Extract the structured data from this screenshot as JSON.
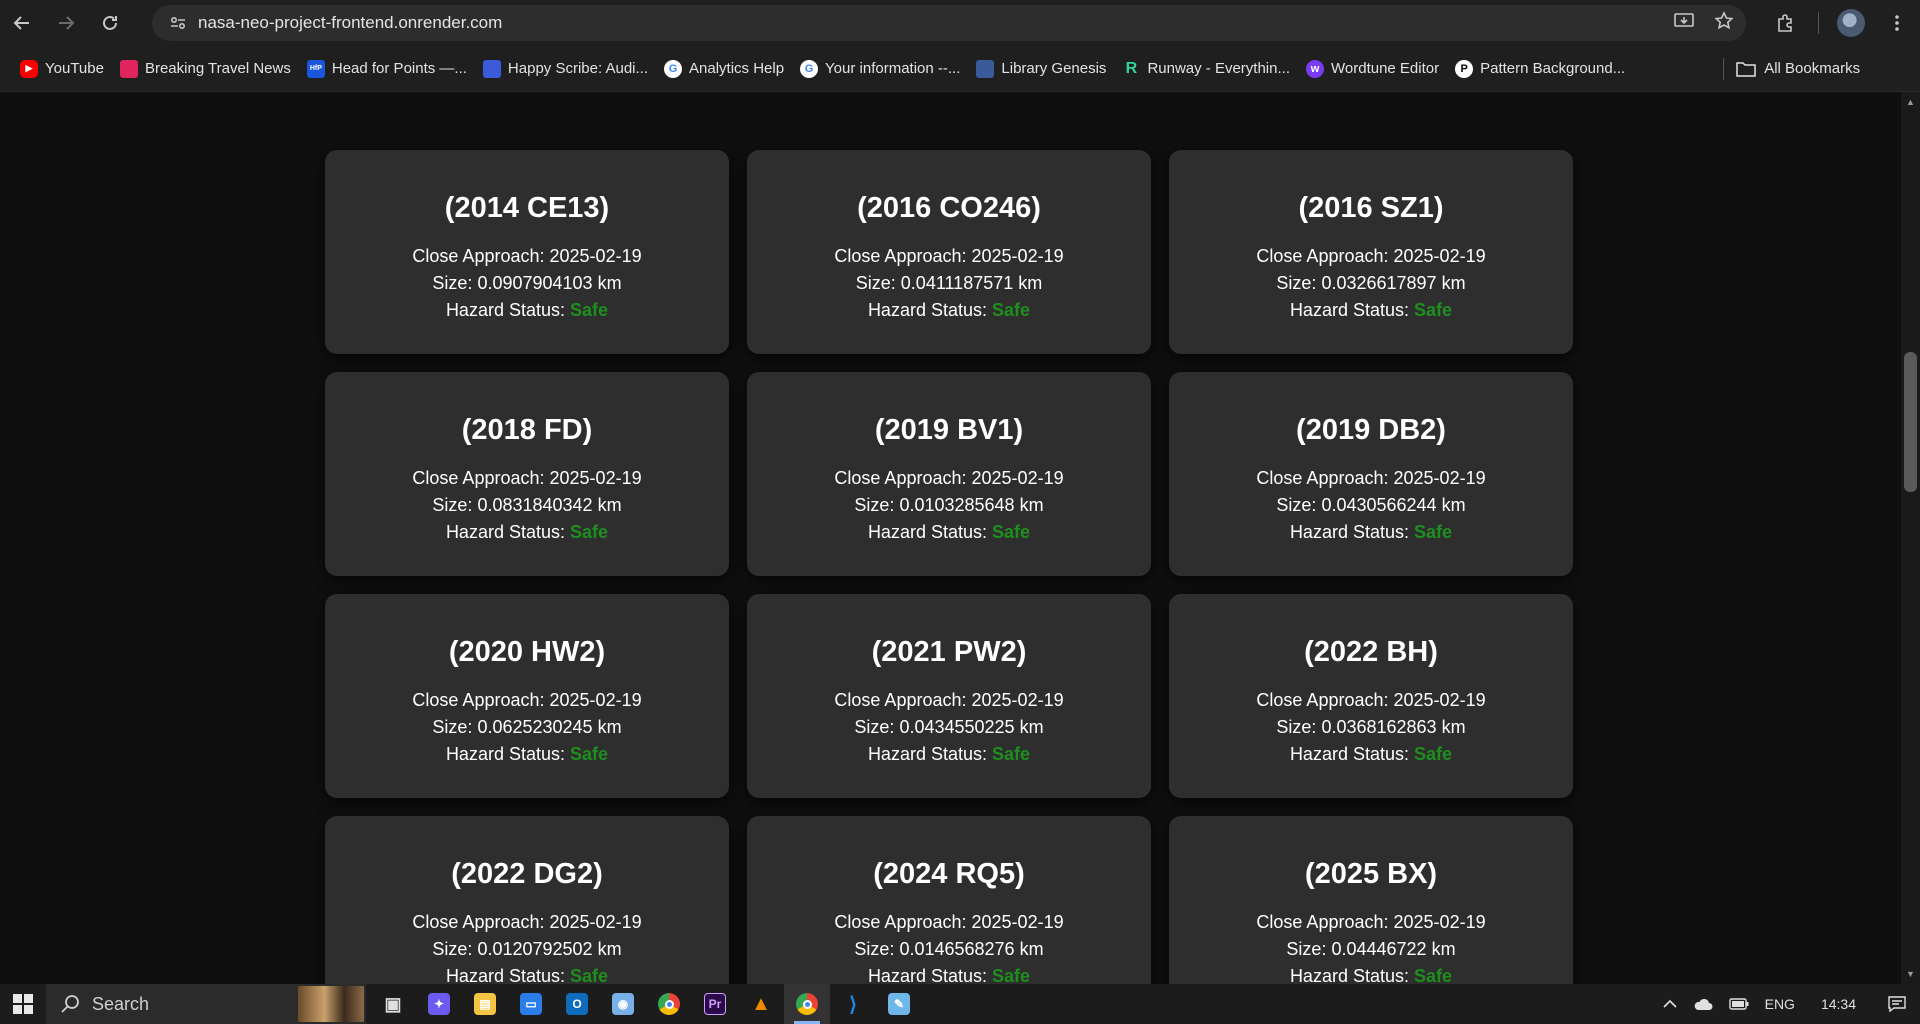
{
  "browser": {
    "url": "nasa-neo-project-frontend.onrender.com",
    "bookmarks": [
      {
        "label": "YouTube",
        "icon": "youtube-icon",
        "color": "#ff0000"
      },
      {
        "label": "Breaking Travel News",
        "icon": "breaking-travel-news-icon",
        "color": "#e0245e"
      },
      {
        "label": "Head for Points —...",
        "icon": "hfp-icon",
        "color": "#1a56db"
      },
      {
        "label": "Happy Scribe: Audi...",
        "icon": "happy-scribe-icon",
        "color": "#3b5bdb"
      },
      {
        "label": "Analytics Help",
        "icon": "google-icon",
        "color": "#4285f4"
      },
      {
        "label": "Your information --...",
        "icon": "google-icon",
        "color": "#4285f4"
      },
      {
        "label": "Library Genesis",
        "icon": "library-genesis-icon",
        "color": "#3a5a9a"
      },
      {
        "label": "Runway - Everythin...",
        "icon": "runway-icon",
        "color": "#2fd3a0"
      },
      {
        "label": "Wordtune Editor",
        "icon": "wordtune-icon",
        "color": "#7a3cf0"
      },
      {
        "label": "Pattern Background...",
        "icon": "pattern-icon",
        "color": "#ffffff"
      }
    ],
    "all_bookmarks_label": "All Bookmarks"
  },
  "neo_cards": [
    {
      "name": "(2014 CE13)",
      "approach_label": "Close Approach:",
      "approach": "2025-02-19",
      "size_label": "Size:",
      "size": "0.0907904103 km",
      "hazard_label": "Hazard Status:",
      "hazard": "Safe"
    },
    {
      "name": "(2016 CO246)",
      "approach_label": "Close Approach:",
      "approach": "2025-02-19",
      "size_label": "Size:",
      "size": "0.0411187571 km",
      "hazard_label": "Hazard Status:",
      "hazard": "Safe"
    },
    {
      "name": "(2016 SZ1)",
      "approach_label": "Close Approach:",
      "approach": "2025-02-19",
      "size_label": "Size:",
      "size": "0.0326617897 km",
      "hazard_label": "Hazard Status:",
      "hazard": "Safe"
    },
    {
      "name": "(2018 FD)",
      "approach_label": "Close Approach:",
      "approach": "2025-02-19",
      "size_label": "Size:",
      "size": "0.0831840342 km",
      "hazard_label": "Hazard Status:",
      "hazard": "Safe"
    },
    {
      "name": "(2019 BV1)",
      "approach_label": "Close Approach:",
      "approach": "2025-02-19",
      "size_label": "Size:",
      "size": "0.0103285648 km",
      "hazard_label": "Hazard Status:",
      "hazard": "Safe"
    },
    {
      "name": "(2019 DB2)",
      "approach_label": "Close Approach:",
      "approach": "2025-02-19",
      "size_label": "Size:",
      "size": "0.0430566244 km",
      "hazard_label": "Hazard Status:",
      "hazard": "Safe"
    },
    {
      "name": "(2020 HW2)",
      "approach_label": "Close Approach:",
      "approach": "2025-02-19",
      "size_label": "Size:",
      "size": "0.0625230245 km",
      "hazard_label": "Hazard Status:",
      "hazard": "Safe"
    },
    {
      "name": "(2021 PW2)",
      "approach_label": "Close Approach:",
      "approach": "2025-02-19",
      "size_label": "Size:",
      "size": "0.0434550225 km",
      "hazard_label": "Hazard Status:",
      "hazard": "Safe"
    },
    {
      "name": "(2022 BH)",
      "approach_label": "Close Approach:",
      "approach": "2025-02-19",
      "size_label": "Size:",
      "size": "0.0368162863 km",
      "hazard_label": "Hazard Status:",
      "hazard": "Safe"
    },
    {
      "name": "(2022 DG2)",
      "approach_label": "Close Approach:",
      "approach": "2025-02-19",
      "size_label": "Size:",
      "size": "0.0120792502 km",
      "hazard_label": "Hazard Status:",
      "hazard": "Safe"
    },
    {
      "name": "(2024 RQ5)",
      "approach_label": "Close Approach:",
      "approach": "2025-02-19",
      "size_label": "Size:",
      "size": "0.0146568276 km",
      "hazard_label": "Hazard Status:",
      "hazard": "Safe"
    },
    {
      "name": "(2025 BX)",
      "approach_label": "Close Approach:",
      "approach": "2025-02-19",
      "size_label": "Size:",
      "size": "0.04446722 km",
      "hazard_label": "Hazard Status:",
      "hazard": "Safe"
    }
  ],
  "colors": {
    "safe": "#1e8f1e",
    "card_bg": "#2e2e2e",
    "page_bg": "#0f0f0f"
  },
  "taskbar": {
    "search_label": "Search",
    "apps": [
      "task-view-icon",
      "copilot-icon",
      "file-explorer-icon",
      "remote-desktop-icon",
      "outlook-icon",
      "photos-icon",
      "chrome-icon",
      "premiere-icon",
      "vlc-icon",
      "chrome-icon",
      "vscode-icon",
      "notepad-icon"
    ],
    "language": "ENG",
    "time": "14:34"
  }
}
